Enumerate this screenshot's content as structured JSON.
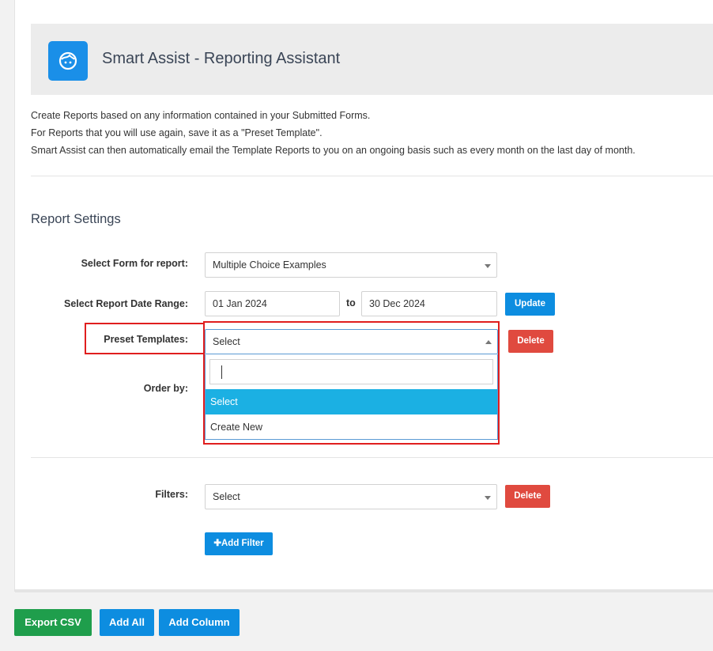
{
  "app": {
    "title": "Smart Assist - Reporting Assistant",
    "logo_icon": "face-icon",
    "accent_color": "#1a8fe8"
  },
  "intro": {
    "line1": "Create Reports based on any information contained in your Submitted Forms.",
    "line2": "For Reports that you will use again, save it as a \"Preset Template\".",
    "line3": "Smart Assist can then automatically email the Template Reports to you on an ongoing basis such as every month on the last day of month."
  },
  "settings": {
    "section_title": "Report Settings",
    "form_label": "Select Form for report:",
    "form_value": "Multiple Choice Examples",
    "date_label": "Select Report Date Range:",
    "date_from": "01 Jan 2024",
    "date_to_word": "to",
    "date_to": "30 Dec 2024",
    "update_label": "Update",
    "preset_label": "Preset Templates:",
    "preset_value": "Select",
    "preset_delete_label": "Delete",
    "preset_options": [
      "Select",
      "Create New"
    ],
    "preset_selected_option": "Select",
    "order_label": "Order by:"
  },
  "filters": {
    "label": "Filters:",
    "value": "Select",
    "delete_label": "Delete",
    "add_filter_label": "Add Filter",
    "add_filter_icon": "plus-icon"
  },
  "footer": {
    "export_csv_label": "Export CSV",
    "add_all_label": "Add All",
    "add_column_label": "Add Column"
  },
  "colors": {
    "primary_button": "#0d8de0",
    "danger_button": "#e04a3f",
    "success_button": "#1f9e4c",
    "highlight_border": "#e01e1e",
    "dropdown_active": "#1bb0e3"
  }
}
